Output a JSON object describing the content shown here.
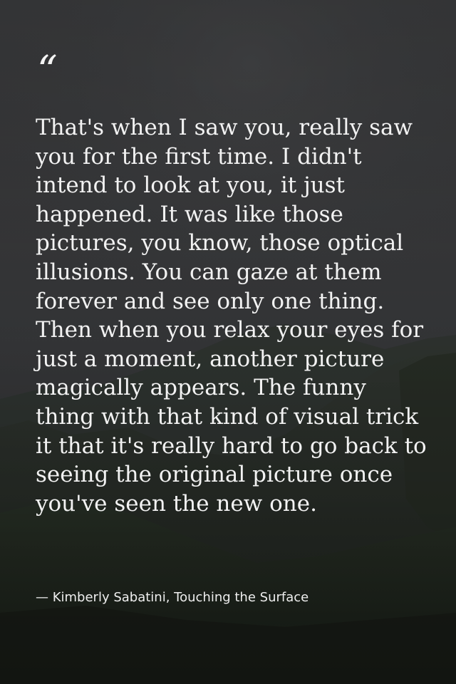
{
  "quote": {
    "mark": "“",
    "text": "That's when I saw you, really saw you for the first time. I didn't intend to look at you, it just happened. It was like those pictures, you know, those optical illusions. You can gaze at them forever and see only one thing. Then when you relax your eyes for just a moment, another picture magically appears. The funny thing with that kind of visual trick it that it's really hard to go back to seeing the original picture once you've seen the new one.",
    "attribution": "— Kimberly Sabatini, Touching the Surface"
  },
  "colors": {
    "text": "#f2f2f2",
    "sky": "#3a3b3d",
    "hills": "#232822"
  }
}
